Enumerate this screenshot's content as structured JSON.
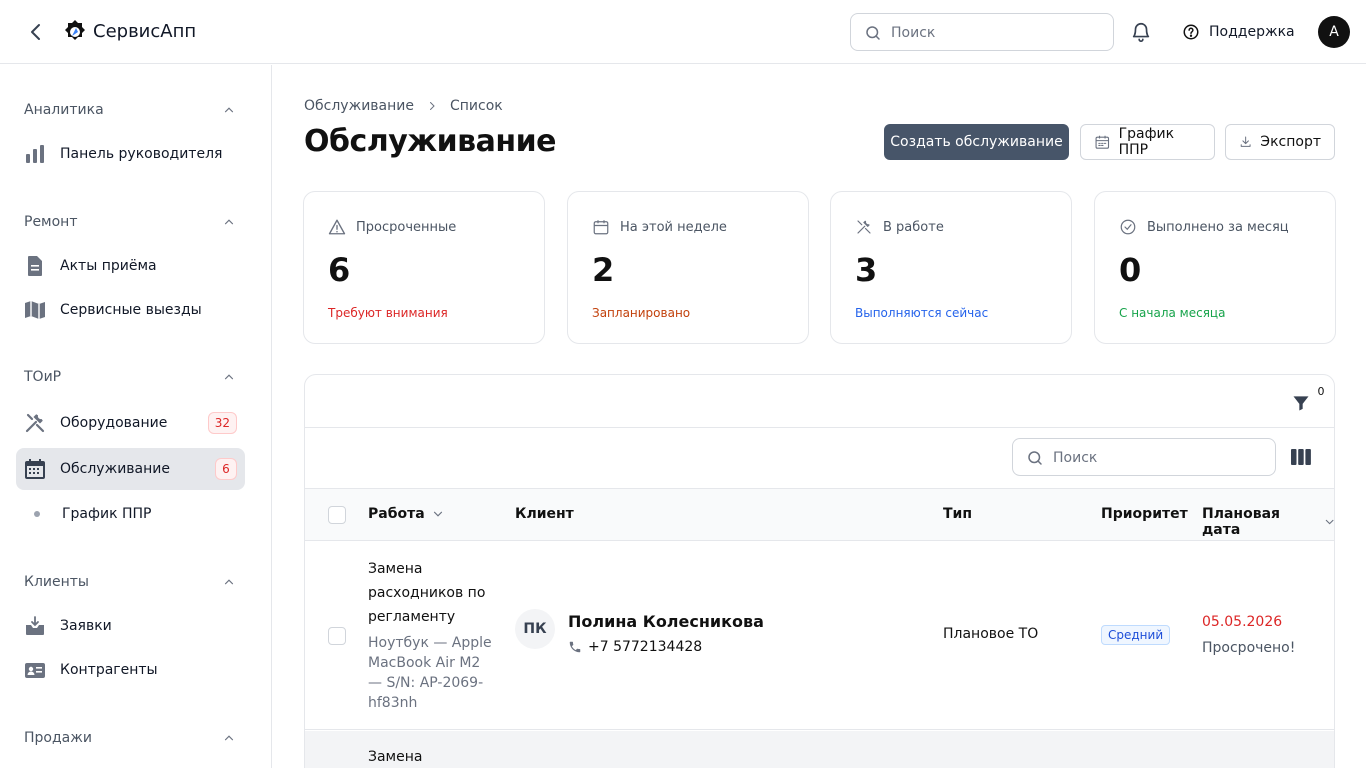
{
  "topbar": {
    "app_name": "СервисАпп",
    "search_placeholder": "Поиск",
    "support_label": "Поддержка",
    "avatar_initial": "A"
  },
  "sidebar": {
    "sections": [
      {
        "title": "Аналитика",
        "items": [
          {
            "label": "Панель руководителя",
            "icon": "bar-chart-icon"
          }
        ]
      },
      {
        "title": "Ремонт",
        "items": [
          {
            "label": "Акты приёма",
            "icon": "document-icon"
          },
          {
            "label": "Сервисные выезды",
            "icon": "map-icon"
          }
        ]
      },
      {
        "title": "ТОиР",
        "items": [
          {
            "label": "Оборудование",
            "icon": "tools-icon",
            "count": "32"
          },
          {
            "label": "Обслуживание",
            "icon": "calendar-icon",
            "count": "6",
            "active": true
          },
          {
            "label": "График ППР",
            "icon": "dot"
          }
        ]
      },
      {
        "title": "Клиенты",
        "items": [
          {
            "label": "Заявки",
            "icon": "inbox-icon"
          },
          {
            "label": "Контрагенты",
            "icon": "contact-card-icon"
          }
        ]
      },
      {
        "title": "Продажи",
        "items": []
      }
    ]
  },
  "page": {
    "breadcrumb": [
      "Обслуживание",
      "Список"
    ],
    "title": "Обслуживание",
    "actions": {
      "create": "Создать обслуживание",
      "schedule": "График ППР",
      "export": "Экспорт"
    }
  },
  "stats": [
    {
      "label": "Просроченные",
      "value": "6",
      "sub": "Требуют внимания",
      "sub_color": "#dc2626",
      "icon": "warning-icon"
    },
    {
      "label": "На этой неделе",
      "value": "2",
      "sub": "Запланировано",
      "sub_color": "#c2410c",
      "icon": "calendar-icon"
    },
    {
      "label": "В работе",
      "value": "3",
      "sub": "Выполняются сейчас",
      "sub_color": "#2563eb",
      "icon": "tools-icon"
    },
    {
      "label": "Выполнено за месяц",
      "value": "0",
      "sub": "С начала месяца",
      "sub_color": "#16a34a",
      "icon": "check-circle-icon"
    }
  ],
  "table": {
    "filter_count": "0",
    "search_placeholder": "Поиск",
    "columns": [
      "Работа",
      "Клиент",
      "Тип",
      "Приоритет",
      "Плановая дата"
    ],
    "rows": [
      {
        "work_title": "Замена расходников по регламенту",
        "work_sub": "Ноутбук — Apple MacBook Air M2 — S/N: AP-2069-hf83nh",
        "client_initials": "ПК",
        "client_name": "Полина Колесникова",
        "client_phone": "+7 5772134428",
        "type": "Плановое ТО",
        "priority": "Средний",
        "date": "05.05.2026",
        "date_status": "Просрочено!"
      },
      {
        "work_title": "Замена"
      }
    ]
  },
  "colors": {
    "accent": "#475569",
    "danger": "#dc2626",
    "border": "#e5e7eb"
  }
}
